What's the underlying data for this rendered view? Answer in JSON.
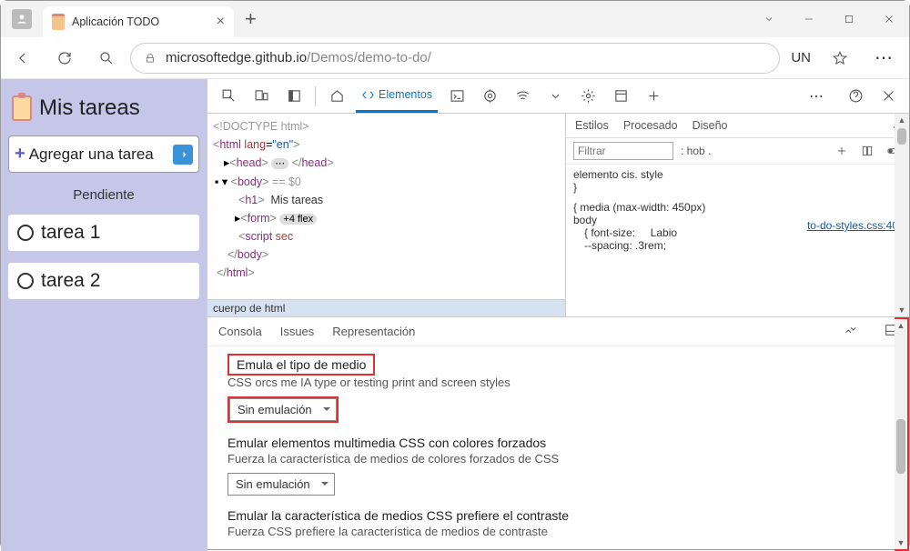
{
  "browser": {
    "tab_title": "Aplicación TODO",
    "url_prefix": "microsoftedge.github.io",
    "url_path": "/Demos/demo-to-do/",
    "profile": "UN"
  },
  "app": {
    "title": "Mis tareas",
    "add_label": "Agregar una tarea",
    "pending_label": "Pendiente",
    "tasks": [
      "tarea 1",
      "tarea 2"
    ]
  },
  "devtools": {
    "elements_tab": "Elementos",
    "dom": {
      "doctype": "<!DOCTYPE html>",
      "html_open": "<html lang=\"en\">",
      "head_open": "<head>",
      "head_close": "</head>",
      "body_open": "<body>",
      "body_marker": "== $0",
      "h1_open": "<h1>",
      "h1_text": "Mis tareas",
      "form_open": "<form>",
      "form_badge": "+4 flex",
      "script": "<script sec",
      "body_close": "</body>",
      "html_close": "</html>",
      "path": "cuerpo de html"
    },
    "styles": {
      "tabs": {
        "estilos": "Estilos",
        "procesado": "Procesado",
        "diseno": "Diseño"
      },
      "filter_placeholder": "Filtrar",
      "hov": ": hob .",
      "element_style": "elemento cis. style",
      "brace": "}",
      "media": "{ media (max-width: 450px)",
      "body": "body",
      "fontsize": "{ font-size:",
      "labio": "Labio",
      "spacing": "--spacing: .3rem;",
      "css_link": "to-do-styles.css:40"
    },
    "drawer": {
      "tabs": {
        "consola": "Consola",
        "issues": "Issues",
        "repr": "Representación"
      },
      "s1_title": "Emula el tipo de medio",
      "s1_desc": "CSS orcs me IA type or testing print and screen styles",
      "s1_value": "Sin emulación",
      "s2_title": "Emular elementos multimedia CSS con colores forzados",
      "s2_desc": "Fuerza la característica de medios de colores forzados de CSS",
      "s2_value": "Sin emulación",
      "s3_title": "Emular la característica de medios CSS prefiere el contraste",
      "s3_desc": "Fuerza CSS prefiere la característica de medios de contraste"
    }
  }
}
